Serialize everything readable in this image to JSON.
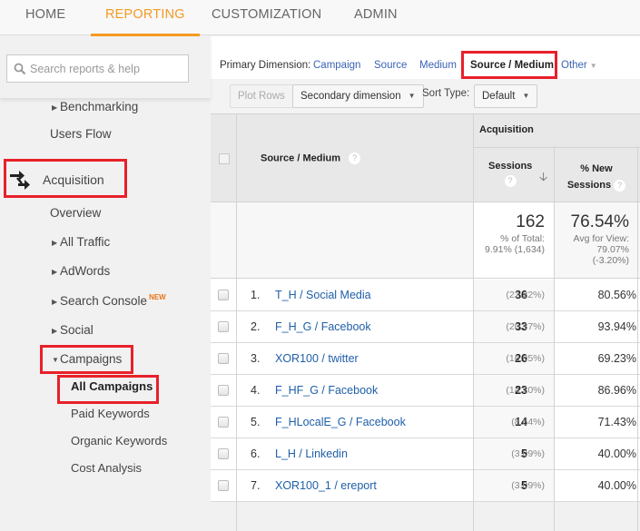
{
  "topnav": {
    "tabs": [
      {
        "label": "HOME",
        "active": false
      },
      {
        "label": "REPORTING",
        "active": true
      },
      {
        "label": "CUSTOMIZATION",
        "active": false
      },
      {
        "label": "ADMIN",
        "active": false
      }
    ]
  },
  "sidebar": {
    "search_placeholder": "Search reports & help",
    "items": {
      "benchmarking": "Benchmarking",
      "users_flow": "Users Flow",
      "acquisition": "Acquisition",
      "overview": "Overview",
      "all_traffic": "All Traffic",
      "adwords": "AdWords",
      "search_console": "Search Console",
      "search_console_badge": "NEW",
      "social": "Social",
      "campaigns": "Campaigns",
      "all_campaigns": "All Campaigns",
      "paid_keywords": "Paid Keywords",
      "organic_keywords": "Organic Keywords",
      "cost_analysis": "Cost Analysis"
    }
  },
  "primary_dimension": {
    "label": "Primary Dimension:",
    "options": [
      "Campaign",
      "Source",
      "Medium",
      "Source / Medium",
      "Other"
    ],
    "selected": "Source / Medium"
  },
  "toolbar": {
    "plot_rows": "Plot Rows",
    "secondary_dimension": "Secondary dimension",
    "sort_type_label": "Sort Type:",
    "sort_type_value": "Default"
  },
  "table": {
    "dimension_header": "Source / Medium",
    "group_header": "Acquisition",
    "col_sessions": "Sessions",
    "col_new_sessions_1": "% New",
    "col_new_sessions_2": "Sessions",
    "summary": {
      "sessions": "162",
      "sessions_sub1": "% of Total:",
      "sessions_sub2": "9.91% (1,634)",
      "new_sessions": "76.54%",
      "new_sub1": "Avg for View:",
      "new_sub2": "79.07%",
      "new_sub3": "(-3.20%)"
    },
    "rows": [
      {
        "index": "1.",
        "name": "T_H / Social Media",
        "sessions": "36",
        "sessions_pct": "(22.22%)",
        "new_sessions": "80.56%"
      },
      {
        "index": "2.",
        "name": "F_H_G / Facebook",
        "sessions": "33",
        "sessions_pct": "(20.37%)",
        "new_sessions": "93.94%"
      },
      {
        "index": "3.",
        "name": "XOR100 / twitter",
        "sessions": "26",
        "sessions_pct": "(16.05%)",
        "new_sessions": "69.23%"
      },
      {
        "index": "4.",
        "name": "F_HF_G / Facebook",
        "sessions": "23",
        "sessions_pct": "(14.20%)",
        "new_sessions": "86.96%"
      },
      {
        "index": "5.",
        "name": "F_HLocalE_G / Facebook",
        "sessions": "14",
        "sessions_pct": "(8.64%)",
        "new_sessions": "71.43%"
      },
      {
        "index": "6.",
        "name": "L_H / Linkedin",
        "sessions": "5",
        "sessions_pct": "(3.09%)",
        "new_sessions": "40.00%"
      },
      {
        "index": "7.",
        "name": "XOR100_1 / ereport",
        "sessions": "5",
        "sessions_pct": "(3.09%)",
        "new_sessions": "40.00%"
      }
    ]
  },
  "colors": {
    "accent_orange": "#f59a23",
    "highlight_red": "#e8202a",
    "link_blue": "#1f5fa8"
  }
}
